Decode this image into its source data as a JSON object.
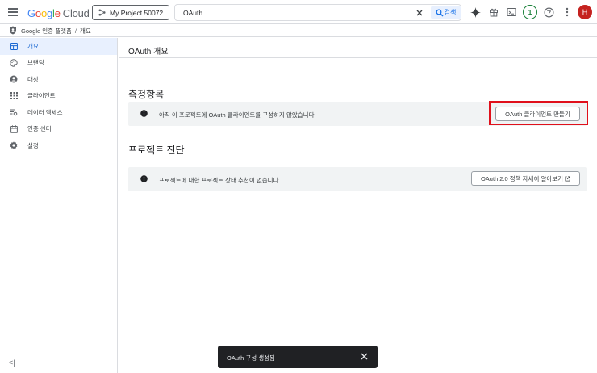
{
  "topbar": {
    "logo_g1": "G",
    "logo_g2": "o",
    "logo_g3": "o",
    "logo_g4": "g",
    "logo_g5": "l",
    "logo_g6": "e",
    "logo_cloud": "Cloud",
    "project": "My Project 50072",
    "search_value": "OAuth",
    "search_button": "검색",
    "notifications_count": "1",
    "avatar_initial": "H"
  },
  "breadcrumb": {
    "product": "Google 인증 플랫폼",
    "separator": "/",
    "page": "개요"
  },
  "sidebar": {
    "items": [
      {
        "label": "개요",
        "icon": "dashboard-icon"
      },
      {
        "label": "브랜딩",
        "icon": "palette-icon"
      },
      {
        "label": "대상",
        "icon": "account-circle-icon"
      },
      {
        "label": "클라이언트",
        "icon": "apps-grid-icon"
      },
      {
        "label": "데이터 액세스",
        "icon": "data-access-icon"
      },
      {
        "label": "인증 센터",
        "icon": "calendar-icon"
      },
      {
        "label": "설정",
        "icon": "gear-icon"
      }
    ],
    "collapse_label": "<|"
  },
  "main": {
    "page_title": "OAuth 개요",
    "metrics": {
      "title": "측정항목",
      "message": "아직 이 프로젝트에 OAuth 클라이언트를 구성하지 않았습니다.",
      "button": "OAuth 클라이언트 만들기"
    },
    "diagnostics": {
      "title": "프로젝트 진단",
      "message": "프로젝트에 대한 프로젝트 상태 추천이 없습니다.",
      "button": "OAuth 2.0 정책 자세히 알아보기"
    }
  },
  "snackbar": {
    "message": "OAuth 구성 생성됨"
  },
  "colors": {
    "accent": "#1a73e8",
    "active_bg": "#e8f0fe",
    "highlight": "#e0101b",
    "avatar": "#c5221f",
    "badge": "#188038"
  }
}
